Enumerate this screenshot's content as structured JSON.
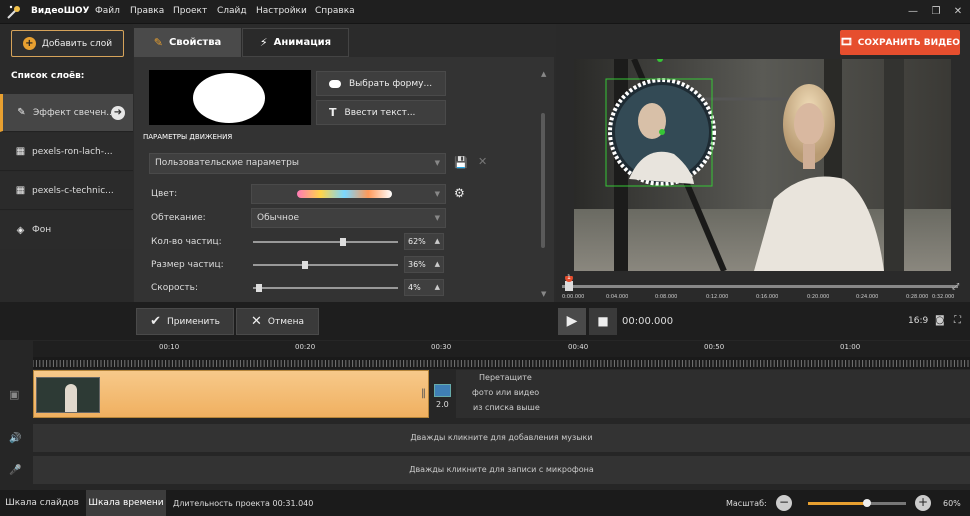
{
  "app": {
    "name": "ВидеоШОУ"
  },
  "menu": [
    "Файл",
    "Правка",
    "Проект",
    "Слайд",
    "Настройки",
    "Справка"
  ],
  "left_panel": {
    "add_layer": "Добавить слой",
    "list_title": "Список слоёв:",
    "layers": [
      "Эффект свечен...",
      "pexels-ron-lach-...",
      "pexels-c-technic...",
      "Фон"
    ]
  },
  "tabs": {
    "effects": "Свойства",
    "animation": "Анимация"
  },
  "settings": {
    "choose_shape": "Выбрать форму...",
    "enter_text": "Ввести текст...",
    "motion_params": "ПАРАМЕТРЫ ДВИЖЕНИЯ",
    "preset": "Пользовательские параметры",
    "color_label": "Цвет:",
    "wrap_label": "Обтекание:",
    "wrap_value": "Обычное",
    "count_label": "Кол-во частиц:",
    "count_value": "62%",
    "count_level": 0.62,
    "size_label": "Размер частиц:",
    "size_value": "36%",
    "size_level": 0.36,
    "speed_label": "Скорость:",
    "speed_value": "4%",
    "speed_level": 0.04
  },
  "actions": {
    "apply": "Применить",
    "cancel": "Отмена"
  },
  "preview": {
    "save": "СОХРАНИТЬ ВИДЕО",
    "time": "00:00.000",
    "ratio": "16:9",
    "marker": "1",
    "ticks": [
      "0:00.000",
      "0:04.000",
      "0:08.000",
      "0:12.000",
      "0:16.000",
      "0:20.000",
      "0:24.000",
      "0:28.000",
      "0:32.000"
    ]
  },
  "timeline": {
    "ticks": [
      "00:10",
      "00:20",
      "00:30",
      "00:40",
      "00:50",
      "01:00"
    ],
    "transition": "2.0",
    "drop_hint_1": "Перетащите",
    "drop_hint_2": "фото или видео",
    "drop_hint_3": "из списка выше",
    "music_hint": "Дважды кликните для добавления музыки",
    "mic_hint": "Дважды кликните для записи с микрофона"
  },
  "status": {
    "slides_tab": "Шкала слайдов",
    "time_tab": "Шкала времени",
    "duration": "Длительность проекта 00:31.040",
    "scale_label": "Масштаб:",
    "scale_value": "60%",
    "scale_level": 0.6
  },
  "colors": {
    "accent": "#e8a030",
    "save": "#e64e2e",
    "clip": "#f0b860"
  }
}
